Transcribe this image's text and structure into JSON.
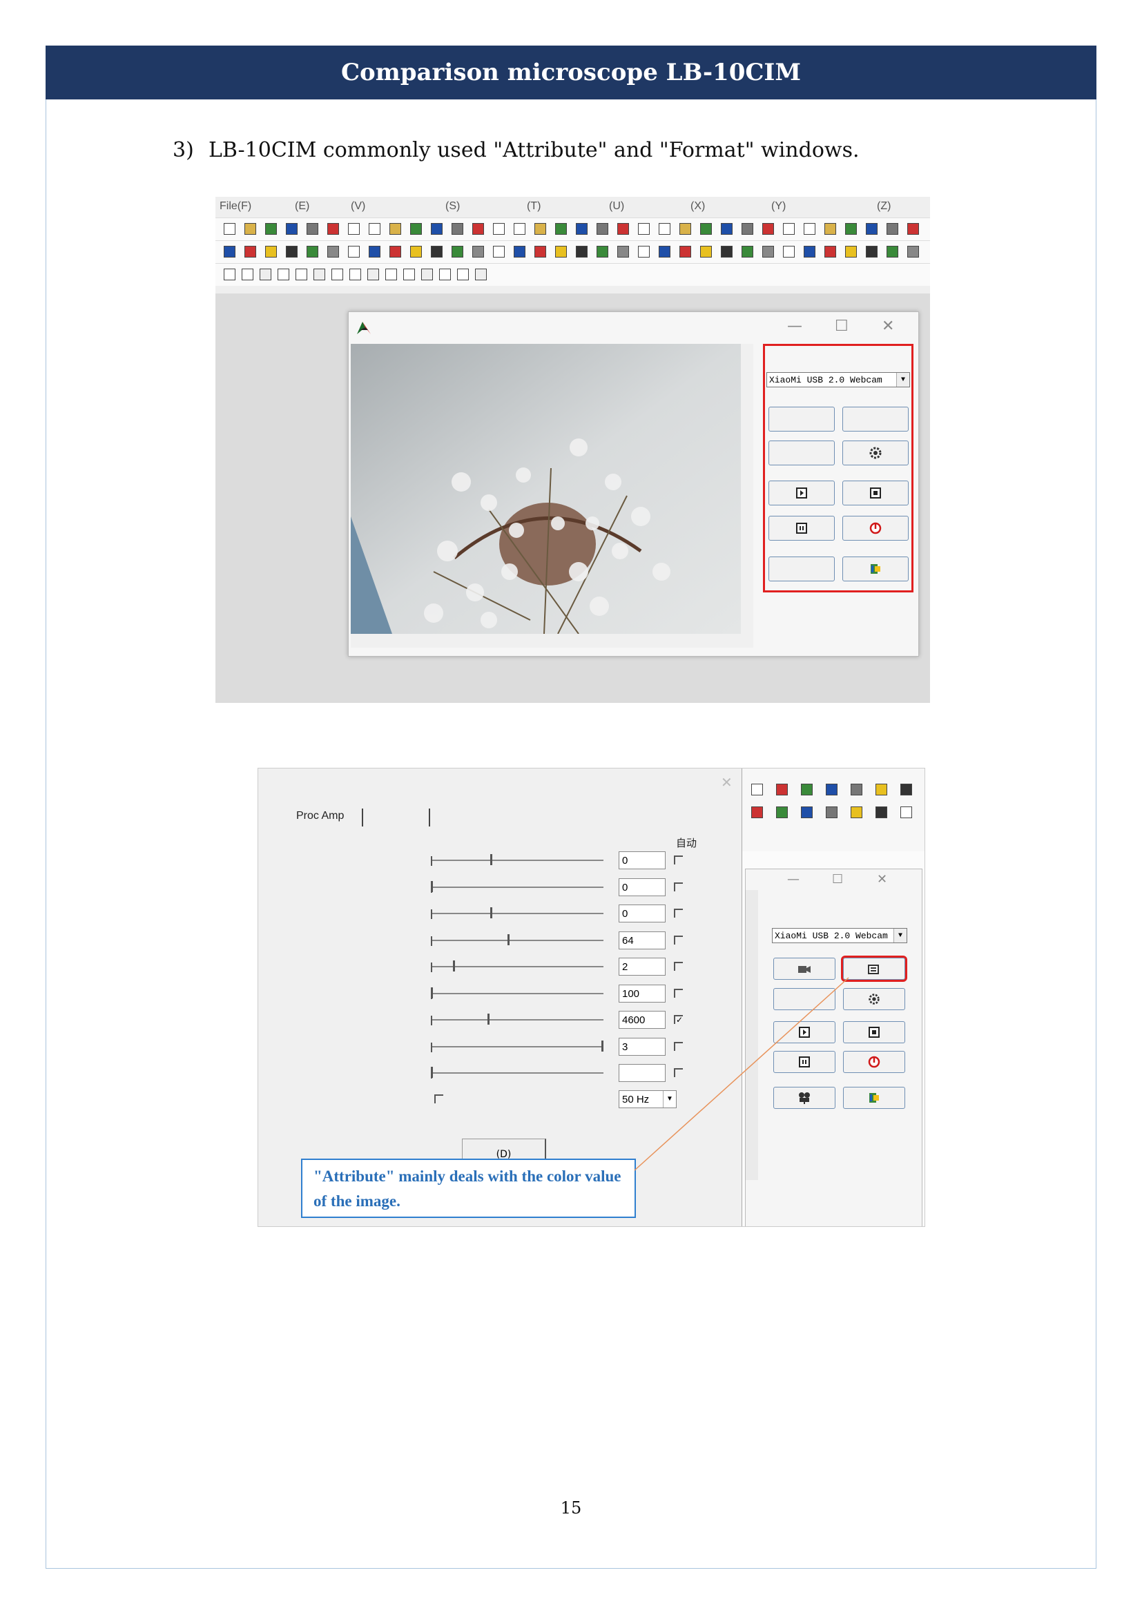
{
  "header": {
    "title": "Comparison microscope LB-10CIM"
  },
  "step": {
    "number": "3)",
    "text": "LB-10CIM commonly used \"Attribute\" and \"Format\" windows."
  },
  "screenshot1": {
    "menu": [
      "File(F)",
      "(E)",
      "(V)",
      "(S)",
      "(T)",
      "(U)",
      "(X)",
      "(Y)",
      "(Z)"
    ],
    "device_select": "XiaoMi USB 2.0 Webcam",
    "window_controls": {
      "minimize": "—",
      "maximize": "☐",
      "close": "✕"
    }
  },
  "screenshot2": {
    "tab_label": "Proc Amp",
    "auto_header": "自动",
    "rows": [
      {
        "value": "0",
        "checked": false,
        "pos": 0.35
      },
      {
        "value": "0",
        "checked": false,
        "pos": 0.0
      },
      {
        "value": "0",
        "checked": false,
        "pos": 0.35
      },
      {
        "value": "64",
        "checked": false,
        "pos": 0.45
      },
      {
        "value": "2",
        "checked": false,
        "pos": 0.13
      },
      {
        "value": "100",
        "checked": false,
        "pos": 0.0
      },
      {
        "value": "4600",
        "checked": true,
        "pos": 0.33
      },
      {
        "value": "3",
        "checked": false,
        "pos": 1.0
      },
      {
        "value": "",
        "checked": false,
        "pos": 0.0
      }
    ],
    "frequency": "50 Hz",
    "default_button": "(D)",
    "callout": "\"Attribute\" mainly deals with the color value of the image.",
    "device_select": "XiaoMi USB 2.0 Webcam"
  },
  "page_number": "15"
}
